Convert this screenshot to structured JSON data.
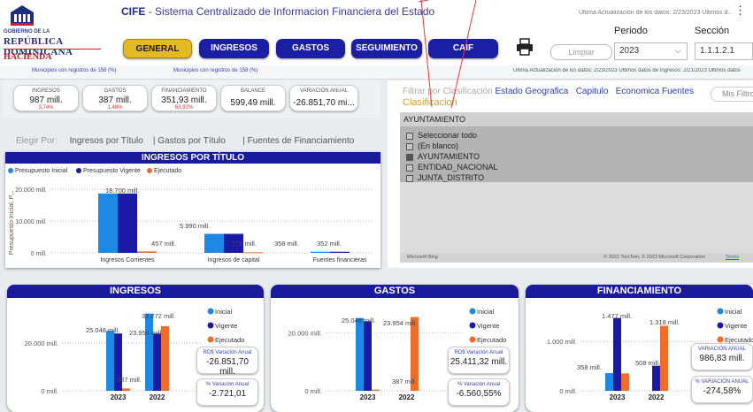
{
  "header": {
    "logo": {
      "line1": "GOBIERNO DE LA",
      "line2": "REPÚBLICA DOMINICANA",
      "line3": "HACIENDA"
    },
    "app_short": "CIFE",
    "app_title": "- Sistema Centralizado de Informacion Financiera del Estado",
    "last_update": "Última Actualización de los datos: 2/23/2023 Últimos d..."
  },
  "nav": {
    "general": "GENERAL",
    "ingresos": "INGRESOS",
    "gastos": "GASTOS",
    "seguimiento": "SEGUIMIENTO",
    "caif": "CAIF",
    "clear": "Limpiar"
  },
  "filters": {
    "periodo_label": "Periodo",
    "periodo_value": "2023",
    "seccion_label": "Sección",
    "seccion_value": "1.1.1.2.1"
  },
  "subbar": {
    "left1": "Municipios con registros de 158 (%)",
    "left2": "Municipios con registros de 158 (%)",
    "right": "Última Actualización de los datos: 2/23/2023 Últimos datos de Ingresos: 2/21/2023 Últimos datos"
  },
  "kpis": [
    {
      "title": "INGRESOS",
      "value": "987 mill.",
      "pct": "3,74%"
    },
    {
      "title": "GASTOS",
      "value": "387 mill.",
      "pct": "1,48%"
    },
    {
      "title": "FINANCIAMIENTO",
      "value": "351,93 mill.",
      "pct": "63,92%"
    },
    {
      "title": "BALANCE",
      "value": "599,49 mill.",
      "pct": ""
    },
    {
      "title": "VARIACIÓN ANUAL",
      "value": "-26.851,70 mi...",
      "pct": ""
    }
  ],
  "selector": {
    "label": "Elegir Por:",
    "opt1": "Ingresos por Título",
    "opt2": "| Gastos por Título",
    "opt3": "| Fuentes de Financiamiento"
  },
  "filter_panel": {
    "filter_by": "Filtrar por",
    "tabs": [
      "Clasificación",
      "Estado",
      "Geografica",
      "Capitulo",
      "Economica",
      "Fuentes"
    ],
    "mis_filtros": "Mis Filtros",
    "clasificacion_label": "Clasificacion",
    "dropdown_value": "AYUNTAMIENTO",
    "options": [
      {
        "label": "Seleccionar todo",
        "checked": false
      },
      {
        "label": "(En blanco)",
        "checked": false
      },
      {
        "label": "AYUNTAMIENTO",
        "checked": true
      },
      {
        "label": "ENTIDAD_NACIONAL",
        "checked": false
      },
      {
        "label": "JUNTA_DISTRITO",
        "checked": false
      }
    ],
    "map_brand": "Microsoft Bing",
    "map_copyright": "© 2022 TomTom, © 2023 Microsoft Corporation",
    "map_terms": "Terms"
  },
  "chart_data": [
    {
      "type": "bar",
      "title": "INGRESOS POR TÍTULO",
      "ylabel": "Presupuesto Inicial, P...",
      "categories": [
        "Ingresos Corrientes",
        "Ingresos de capital",
        "Fuentes financieras"
      ],
      "series": [
        {
          "name": "Presupuesto Inicial",
          "values": [
            18700,
            5990,
            358
          ],
          "color": "#1e88e5"
        },
        {
          "name": "Presupuesto Vigente",
          "values": [
            18700,
            5990,
            352
          ],
          "color": "#1a1aa6"
        },
        {
          "name": "Ejecutado",
          "values": [
            457,
            178,
            0
          ],
          "color": "#ef6c2a"
        }
      ],
      "data_labels": [
        "18.700 mill.",
        "5.990 mill.",
        "457 mill.",
        "178 mill.",
        "358 mill.",
        "352 mill."
      ],
      "yticks": [
        "0 mill.",
        "10.000 mill.",
        "20.000 mill."
      ],
      "ylim": [
        0,
        22000
      ]
    },
    {
      "type": "bar",
      "title": "INGRESOS",
      "categories": [
        "2023",
        "2022"
      ],
      "series": [
        {
          "name": "Inicial",
          "values": [
            25048,
            32272
          ],
          "color": "#1e88e5"
        },
        {
          "name": "Vigente",
          "values": [
            23954,
            23954
          ],
          "color": "#1a1aa6"
        },
        {
          "name": "Ejecutado",
          "values": [
            987,
            27000
          ],
          "color": "#ef6c2a"
        }
      ],
      "data_labels": [
        "25.048 mill.",
        "23.954 mill.",
        "32.272 mill.",
        "987 mill."
      ],
      "yticks": [
        "0 mill.",
        "20.000 mill."
      ],
      "ylim": [
        0,
        34000
      ],
      "boxes": [
        {
          "title": "RD$ Variación Anual",
          "value": "-26.851,70 mill."
        },
        {
          "title": "% Variación Anual",
          "value": "-2.721,01"
        }
      ]
    },
    {
      "type": "bar",
      "title": "GASTOS",
      "categories": [
        "2023",
        "2022"
      ],
      "series": [
        {
          "name": "Inicial",
          "values": [
            25048,
            0
          ],
          "color": "#1e88e5"
        },
        {
          "name": "Vigente",
          "values": [
            23954,
            0
          ],
          "color": "#1a1aa6"
        },
        {
          "name": "Ejecutado",
          "values": [
            387,
            25400
          ],
          "color": "#ef6c2a"
        }
      ],
      "data_labels": [
        "25.048 mill.",
        "23.954 mill.",
        "387 mill."
      ],
      "yticks": [
        "0 mill.",
        "20.000 mill."
      ],
      "ylim": [
        0,
        28000
      ],
      "boxes": [
        {
          "title": "RD$ Variación Anual",
          "value": "25.411,32 mill."
        },
        {
          "title": "% Variación Anual",
          "value": "-6.560,55%"
        }
      ]
    },
    {
      "type": "bar",
      "title": "FINANCIAMIENTO",
      "categories": [
        "2023",
        "2022"
      ],
      "series": [
        {
          "name": "Inicial",
          "values": [
            358,
            0
          ],
          "color": "#1e88e5"
        },
        {
          "name": "Vigente",
          "values": [
            1477,
            508
          ],
          "color": "#1a1aa6"
        },
        {
          "name": "Ejecutado",
          "values": [
            352,
            1318
          ],
          "color": "#ef6c2a"
        }
      ],
      "data_labels": [
        "1.477 mill.",
        "1.318 mill.",
        "358 mill.",
        "508 mill."
      ],
      "yticks": [
        "0 mill.",
        "1.000 mill."
      ],
      "ylim": [
        0,
        1650
      ],
      "boxes": [
        {
          "title": "VARIACIÓN ANUAL",
          "value": "986,83 mill."
        },
        {
          "title": "% VARIACIÓN ANUAL",
          "value": "-274,58%"
        }
      ]
    }
  ]
}
